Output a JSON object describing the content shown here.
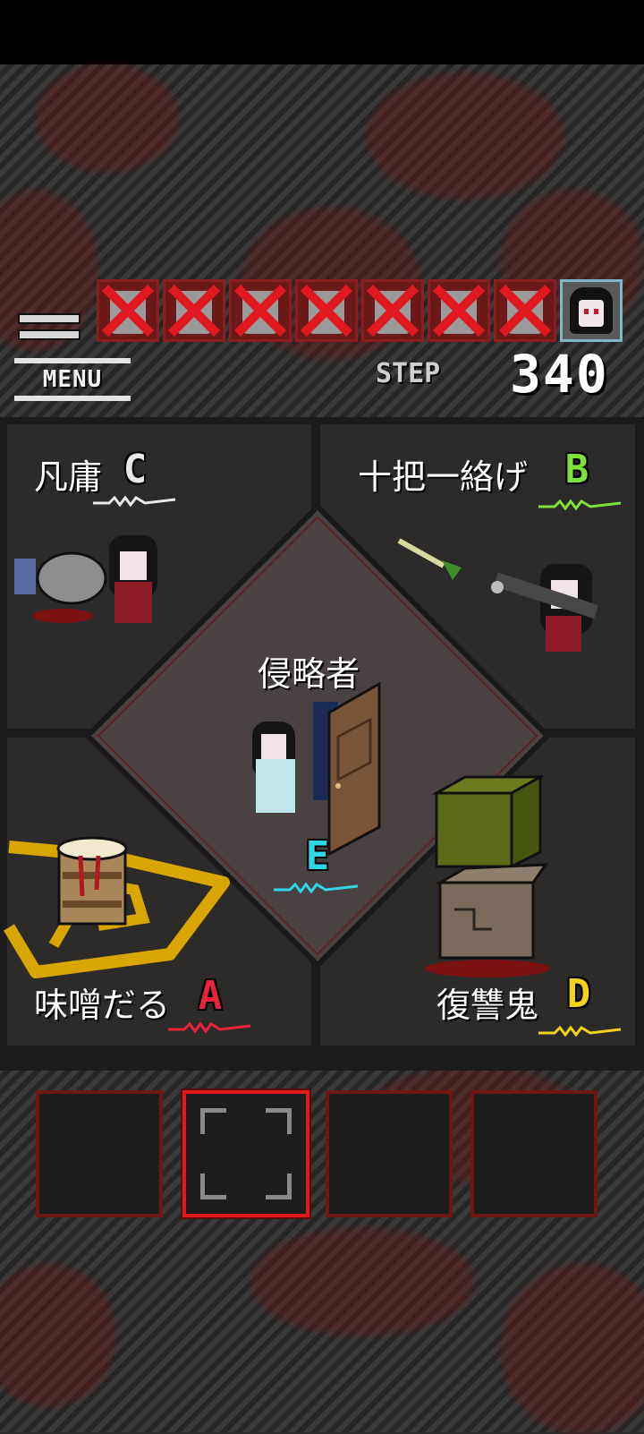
{
  "lives": {
    "lost": 7,
    "remaining": 1
  },
  "menu": {
    "label": "MENU"
  },
  "step": {
    "label": "STEP",
    "value": "340"
  },
  "center": {
    "label": "侵略者",
    "rank": "E",
    "rank_color": "#2fd7e6"
  },
  "quadrants": {
    "top_left": {
      "label": "凡庸",
      "rank": "C",
      "rank_color": "#e8e8e8"
    },
    "top_right": {
      "label": "十把一絡げ",
      "rank": "B",
      "rank_color": "#7ee23b"
    },
    "bottom_left": {
      "label": "味噌だる",
      "rank": "A",
      "rank_color": "#e8243a"
    },
    "bottom_right": {
      "label": "復讐鬼",
      "rank": "D",
      "rank_color": "#f2d21a"
    }
  },
  "inventory": {
    "slots": 4,
    "selected_slot": 2
  },
  "icons": [
    "menu-icon",
    "cross-icon",
    "door-icon",
    "drum-icon",
    "cube-icon"
  ]
}
